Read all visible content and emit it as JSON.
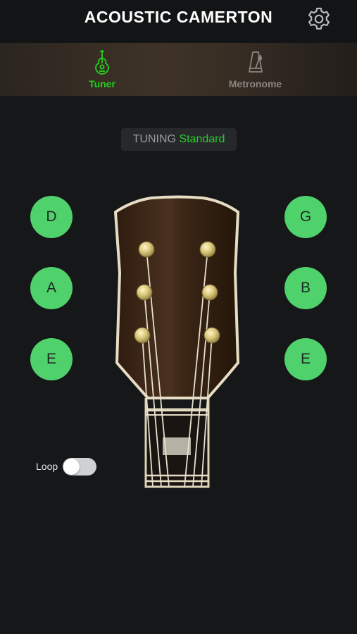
{
  "header": {
    "title": "ACOUSTIC CAMERTON",
    "settings_icon": "gear-icon"
  },
  "tabs": [
    {
      "label": "Tuner",
      "icon": "guitar-icon",
      "active": true,
      "color": "#22d11c"
    },
    {
      "label": "Metronome",
      "icon": "metronome-icon",
      "active": false,
      "color": "#8a8580"
    }
  ],
  "tuning": {
    "label": "TUNING",
    "value": "Standard"
  },
  "strings": {
    "left": [
      "D",
      "A",
      "E"
    ],
    "right": [
      "G",
      "B",
      "E"
    ],
    "button_color": "#4fd16c"
  },
  "loop": {
    "label": "Loop",
    "enabled": false
  }
}
